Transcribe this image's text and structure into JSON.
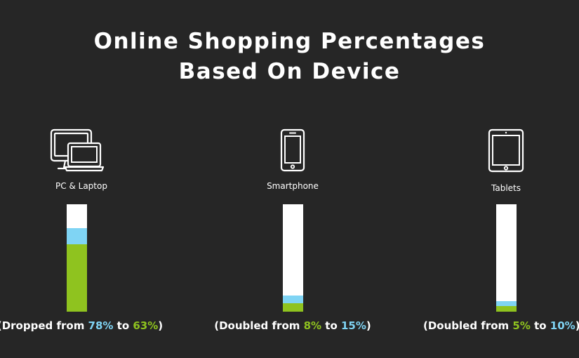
{
  "title": {
    "line1": "Online Shopping Percentages",
    "line2": "Based On Device"
  },
  "colors": {
    "background": "#262626",
    "bar_track": "#ffffff",
    "light_blue": "#7fd4f4",
    "green": "#8fc31f"
  },
  "devices": [
    {
      "label": "PC & Laptop",
      "icon": "computer-laptop-icon",
      "caption": {
        "prefix": "(Dropped from ",
        "first": "78%",
        "middle": " to ",
        "second": "63%",
        "suffix": ")",
        "first_color": "#7fd4f4",
        "second_color": "#8fc31f"
      }
    },
    {
      "label": "Smartphone",
      "icon": "smartphone-icon",
      "caption": {
        "prefix": "(Doubled from ",
        "first": "8%",
        "middle": " to ",
        "second": "15%",
        "suffix": ")",
        "first_color": "#8fc31f",
        "second_color": "#7fd4f4"
      }
    },
    {
      "label": "Tablets",
      "icon": "tablet-icon",
      "caption": {
        "prefix": "(Doubled from ",
        "first": "5%",
        "middle": " to ",
        "second": "10%",
        "suffix": ")",
        "first_color": "#8fc31f",
        "second_color": "#7fd4f4"
      }
    }
  ],
  "chart_data": {
    "type": "bar",
    "title": "Online Shopping Percentages Based On Device",
    "categories": [
      "PC & Laptop",
      "Smartphone",
      "Tablets"
    ],
    "ylim": [
      0,
      100
    ],
    "series": [
      {
        "values": [
          78,
          15,
          10
        ],
        "color": "#7fd4f4"
      },
      {
        "values": [
          63,
          8,
          5
        ],
        "color": "#8fc31f"
      }
    ]
  }
}
